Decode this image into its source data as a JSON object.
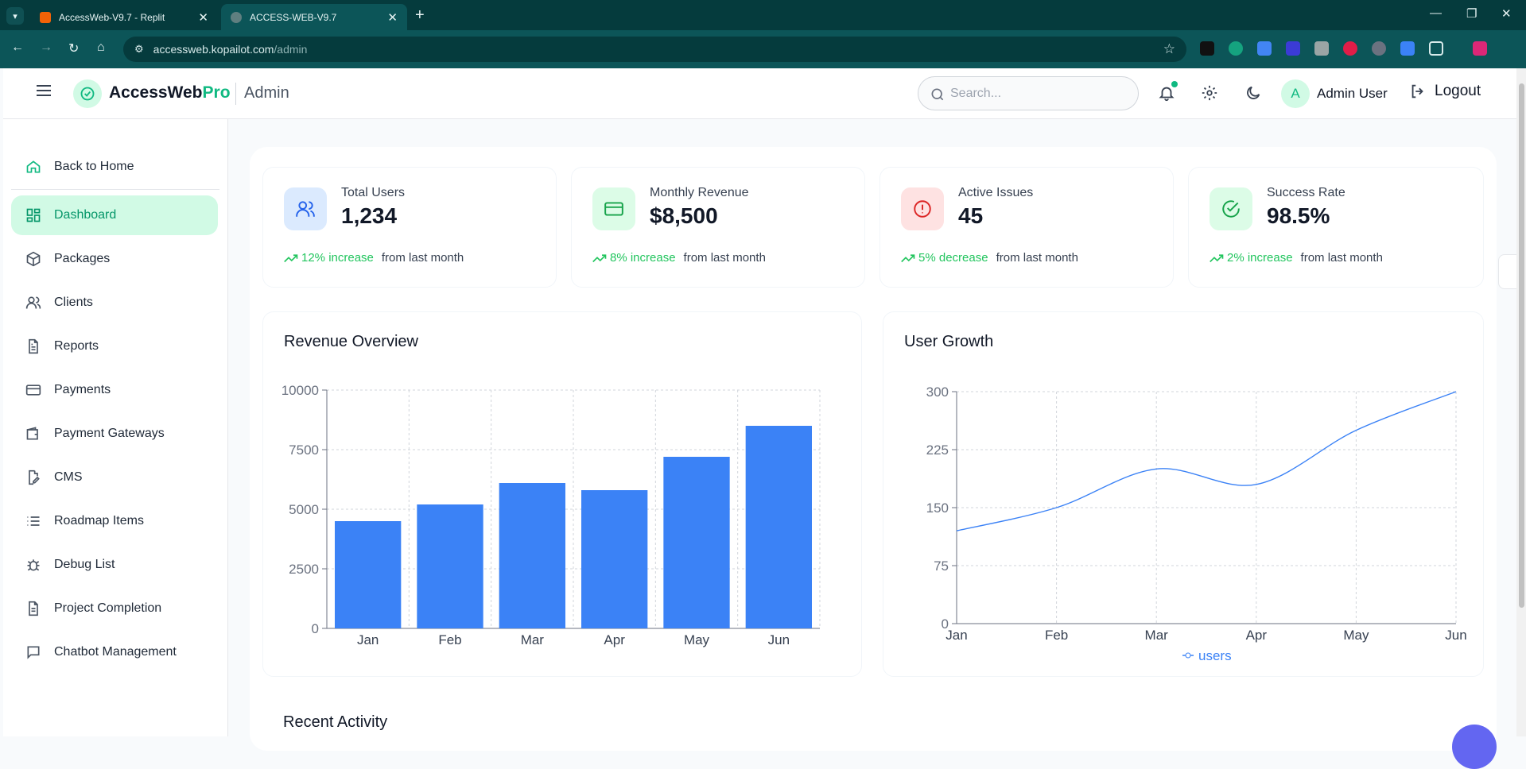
{
  "browser": {
    "tabs": [
      {
        "title": "AccessWeb-V9.7 - Replit",
        "active": false
      },
      {
        "title": "ACCESS-WEB-V9.7",
        "active": true
      }
    ],
    "url_host": "accessweb.kopailot.com",
    "url_path": "/admin"
  },
  "header": {
    "brand_main": "AccessWeb",
    "brand_accent": "Pro",
    "section": "Admin",
    "search_placeholder": "Search...",
    "user_initial": "A",
    "user_name": "Admin User",
    "logout_label": "Logout"
  },
  "sidebar": {
    "items": [
      {
        "label": "Back to Home",
        "icon": "home-icon"
      },
      {
        "label": "Dashboard",
        "icon": "grid-icon",
        "active": true
      },
      {
        "label": "Packages",
        "icon": "package-icon"
      },
      {
        "label": "Clients",
        "icon": "users-icon"
      },
      {
        "label": "Reports",
        "icon": "file-text-icon"
      },
      {
        "label": "Payments",
        "icon": "credit-card-icon"
      },
      {
        "label": "Payment Gateways",
        "icon": "wallet-icon"
      },
      {
        "label": "CMS",
        "icon": "file-edit-icon"
      },
      {
        "label": "Roadmap Items",
        "icon": "list-icon"
      },
      {
        "label": "Debug List",
        "icon": "bug-icon"
      },
      {
        "label": "Project Completion",
        "icon": "file-check-icon"
      },
      {
        "label": "Chatbot Management",
        "icon": "message-icon"
      }
    ]
  },
  "stats": [
    {
      "label": "Total Users",
      "value": "1,234",
      "trend": "12% increase",
      "trend_rest": "from last month",
      "icon": "users-icon",
      "icon_bg": "#dbeafe",
      "icon_color": "#2563eb"
    },
    {
      "label": "Monthly Revenue",
      "value": "$8,500",
      "trend": "8% increase",
      "trend_rest": "from last month",
      "icon": "credit-card-icon",
      "icon_bg": "#dcfce7",
      "icon_color": "#16a34a"
    },
    {
      "label": "Active Issues",
      "value": "45",
      "trend": "5% decrease",
      "trend_rest": "from last month",
      "icon": "alert-circle-icon",
      "icon_bg": "#fee2e2",
      "icon_color": "#dc2626"
    },
    {
      "label": "Success Rate",
      "value": "98.5%",
      "trend": "2% increase",
      "trend_rest": "from last month",
      "icon": "check-circle-icon",
      "icon_bg": "#dcfce7",
      "icon_color": "#16a34a"
    }
  ],
  "recent_activity_title": "Recent Activity",
  "colors": {
    "accent": "#10b981",
    "bar": "#3b82f6",
    "line": "#3b82f6",
    "trend_green": "#22c55e"
  },
  "chart_data": [
    {
      "type": "bar",
      "title": "Revenue Overview",
      "categories": [
        "Jan",
        "Feb",
        "Mar",
        "Apr",
        "May",
        "Jun"
      ],
      "values": [
        4500,
        5200,
        6100,
        5800,
        7200,
        8500
      ],
      "yticks": [
        "0",
        "2500",
        "5000",
        "7500",
        "10000"
      ],
      "ylim": [
        0,
        10000
      ],
      "grid": true
    },
    {
      "type": "line",
      "title": "User Growth",
      "categories": [
        "Jan",
        "Feb",
        "Mar",
        "Apr",
        "May",
        "Jun"
      ],
      "series": [
        {
          "name": "users",
          "values": [
            120,
            150,
            200,
            180,
            250,
            300
          ]
        }
      ],
      "yticks": [
        "0",
        "75",
        "150",
        "225",
        "300"
      ],
      "ylim": [
        0,
        300
      ],
      "grid": true,
      "legend": "bottom"
    }
  ]
}
